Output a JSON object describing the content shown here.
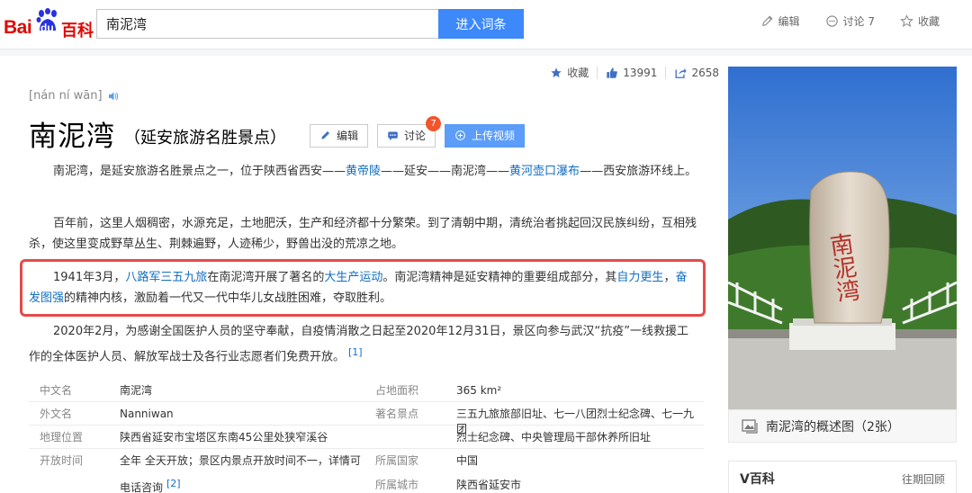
{
  "header": {
    "logo_bai": "Bai",
    "logo_du": "du",
    "logo_baike": "百科",
    "search_value": "南泥湾",
    "search_button": "进入词条",
    "actions": [
      {
        "label": "编辑",
        "icon": "pencil-icon"
      },
      {
        "label": "讨论 7",
        "icon": "chat-icon"
      },
      {
        "label": "收藏",
        "icon": "star-outline-icon"
      }
    ]
  },
  "stats": {
    "favorite_label": "收藏",
    "likes": "13991",
    "shares": "2658"
  },
  "entry": {
    "pinyin": "[nán ní wān]",
    "title": "南泥湾",
    "subtitle": "（延安旅游名胜景点）",
    "edit_button": "编辑",
    "discuss_button": "讨论",
    "discuss_count": "7",
    "upload_button": "上传视频"
  },
  "paragraphs": {
    "p1": {
      "t1": "南泥湾，是延安旅游名胜景点之一，位于陕西省西安——",
      "l1": "黄帝陵",
      "t2": "——延安——南泥湾——",
      "l2": "黄河壶口瀑布",
      "t3": "——西安旅游环线上。"
    },
    "p2": {
      "t1": "百年前，这里人烟稠密，水源充足，土地肥沃，生产和经济都十分繁荣。到了清朝中期，清统治者挑起回汉民族纠纷，互相残杀，使这里变成野草丛生、荆棘遍野，人迹稀少，野兽出没的荒凉之地。"
    },
    "p3": {
      "t1": "1941年3月，",
      "l1": "八路军三五九旅",
      "t2": "在南泥湾开展了著名的",
      "l2": "大生产运动",
      "t3": "。南泥湾精神是延安精神的重要组成部分，其",
      "l3": "自力更生",
      "t4": "，",
      "l4": "奋发图强",
      "t5": "的精神内核，激励着一代又一代中华儿女战胜困难，夺取胜利。"
    },
    "p4": {
      "t1": "2020年2月，为感谢全国医护人员的坚守奉献，自疫情消散之日起至2020年12月31日，景区向参与武汉“抗疫”一线救援工作的全体医护人员、解放军战士及各行业志愿者们免费开放。",
      "ref": "[1]"
    }
  },
  "infobox": {
    "rows": [
      {
        "l1": "中文名",
        "v1": "南泥湾",
        "l2": "占地面积",
        "v2": "365 km²"
      },
      {
        "l1": "外文名",
        "v1": "Nanniwan",
        "l2": "著名景点",
        "v2": "三五九旅旅部旧址、七一八团烈士纪念碑、七一九团"
      },
      {
        "l1": "地理位置",
        "v1": "陕西省延安市宝塔区东南45公里处狭窄溪谷",
        "l2": "",
        "v2": "烈士纪念碑、中央管理局干部休养所旧址"
      },
      {
        "l1": "开放时间",
        "v1": "全年 全天开放；景区内景点开放时间不一，详情可电话咨询",
        "ref": "[2]",
        "l2": "所属国家",
        "v2": "中国",
        "l3": "所属城市",
        "v3": "陕西省延安市"
      }
    ]
  },
  "side": {
    "stone_text": "南泥湾",
    "caption": "南泥湾的概述图（2张）",
    "vbaike_title": "V百科",
    "vbaike_link": "往期回顾"
  },
  "colors": {
    "brand_red": "#e10601",
    "search_blue": "#3e89fa",
    "link_blue": "#136ec2",
    "highlight_red": "#e54a4a"
  }
}
